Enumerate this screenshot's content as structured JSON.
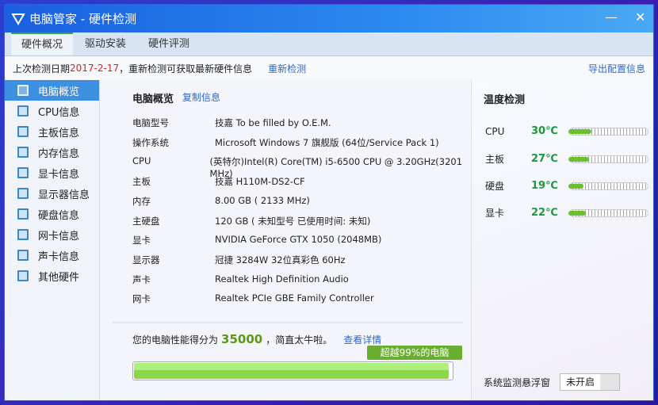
{
  "window": {
    "title": "电脑管家 - 硬件检测",
    "minimize": "—",
    "close": "✕"
  },
  "tabs": [
    {
      "label": "硬件概况"
    },
    {
      "label": "驱动安装"
    },
    {
      "label": "硬件评测"
    }
  ],
  "infobar": {
    "prefix": "上次检测日期 ",
    "date": "2017-2-17",
    "suffix": "，重新检测可获取最新硬件信息",
    "recheck": "重新检测",
    "export": "导出配置信息"
  },
  "sidebar": [
    {
      "label": "电脑概览",
      "icon": "clipboard-icon"
    },
    {
      "label": "CPU信息",
      "icon": "cpu-icon"
    },
    {
      "label": "主板信息",
      "icon": "motherboard-icon"
    },
    {
      "label": "内存信息",
      "icon": "memory-icon"
    },
    {
      "label": "显卡信息",
      "icon": "gpu-icon"
    },
    {
      "label": "显示器信息",
      "icon": "monitor-icon"
    },
    {
      "label": "硬盘信息",
      "icon": "harddisk-icon"
    },
    {
      "label": "网卡信息",
      "icon": "network-card-icon"
    },
    {
      "label": "声卡信息",
      "icon": "sound-card-icon"
    },
    {
      "label": "其他硬件",
      "icon": "other-hardware-icon"
    }
  ],
  "overview": {
    "title": "电脑概览",
    "copy": "复制信息",
    "rows": [
      {
        "k": "电脑型号",
        "v": "技嘉 To be filled by O.E.M."
      },
      {
        "k": "操作系统",
        "v": "Microsoft Windows 7 旗舰版 (64位/Service Pack 1)"
      },
      {
        "k": "CPU",
        "v": "(英特尔)Intel(R) Core(TM) i5-6500 CPU @ 3.20GHz(3201 MHz)"
      },
      {
        "k": "主板",
        "v": "技嘉 H110M-DS2-CF"
      },
      {
        "k": "内存",
        "v": "8.00 GB (   2133 MHz)"
      },
      {
        "k": "主硬盘",
        "v": "120 GB ( 未知型号 已使用时间: 未知)"
      },
      {
        "k": "显卡",
        "v": "NVIDIA GeForce GTX 1050 (2048MB)"
      },
      {
        "k": "显示器",
        "v": "冠捷 3284W 32位真彩色 60Hz"
      },
      {
        "k": "声卡",
        "v": "Realtek High Definition Audio"
      },
      {
        "k": "网卡",
        "v": "Realtek PCIe GBE Family Controller"
      }
    ]
  },
  "score": {
    "prefix": "您的电脑性能得分为",
    "value": "35000",
    "suffix": "，简直太牛啦。",
    "details": "查看详情",
    "badge": "超越99%的电脑",
    "percent": 99
  },
  "temperature": {
    "title": "温度检测",
    "items": [
      {
        "k": "CPU",
        "v": "30℃",
        "level": 0.3
      },
      {
        "k": "主板",
        "v": "27℃",
        "level": 0.27
      },
      {
        "k": "硬盘",
        "v": "19℃",
        "level": 0.19
      },
      {
        "k": "显卡",
        "v": "22℃",
        "level": 0.22
      }
    ]
  },
  "monitor": {
    "label": "系统监测悬浮窗",
    "toggle": "未开启"
  },
  "colors": {
    "accent": "#3d8fe0",
    "green": "#1a9a3a",
    "date": "#e02020"
  }
}
